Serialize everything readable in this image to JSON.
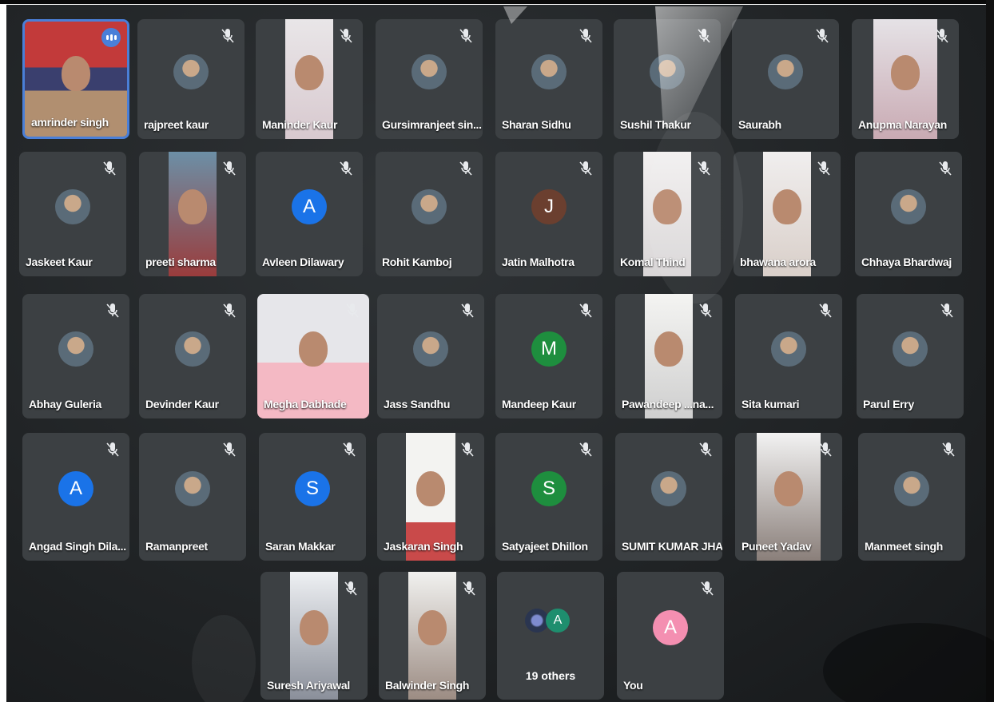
{
  "meeting": {
    "participants": [
      {
        "name": "amrinder singh",
        "pinned": true
      },
      {
        "name": "rajpreet kaur"
      },
      {
        "name": "Maninder Kaur"
      },
      {
        "name": "Gursimranjeet sin..."
      },
      {
        "name": "Sharan Sidhu"
      },
      {
        "name": "Sushil Thakur"
      },
      {
        "name": "Saurabh"
      },
      {
        "name": "Anupma Narayan"
      },
      {
        "name": "Jaskeet Kaur"
      },
      {
        "name": "preeti sharma"
      },
      {
        "name": "Avleen Dilawary",
        "initial": "A"
      },
      {
        "name": "Rohit Kamboj"
      },
      {
        "name": "Jatin Malhotra",
        "initial": "J"
      },
      {
        "name": "Komal Thind"
      },
      {
        "name": "bhawana arora"
      },
      {
        "name": "Chhaya Bhardwaj"
      },
      {
        "name": "Abhay Guleria"
      },
      {
        "name": "Devinder Kaur"
      },
      {
        "name": "Megha Dabhade"
      },
      {
        "name": "Jass Sandhu"
      },
      {
        "name": "Mandeep Kaur",
        "initial": "M"
      },
      {
        "name": "Pawandeep ...na..."
      },
      {
        "name": "Sita kumari"
      },
      {
        "name": "Parul Erry"
      },
      {
        "name": "Angad Singh Dila...",
        "initial": "A"
      },
      {
        "name": "Ramanpreet"
      },
      {
        "name": "Saran Makkar",
        "initial": "S"
      },
      {
        "name": "Jaskaran Singh"
      },
      {
        "name": "Satyajeet Dhillon",
        "initial": "S"
      },
      {
        "name": "SUMIT KUMAR JHA"
      },
      {
        "name": "Puneet Yadav"
      },
      {
        "name": "Manmeet singh"
      },
      {
        "name": "Suresh Ariyawal"
      },
      {
        "name": "Balwinder Singh"
      }
    ],
    "others": {
      "label": "19 others",
      "initial": "A"
    },
    "self": {
      "name": "You",
      "initial": "A"
    },
    "colors": {
      "tile": "#3c4043",
      "accent": "#4a7fd8",
      "avatar_blue": "#1a73e8",
      "avatar_green": "#1e8e3e",
      "avatar_pink": "#f48fb1"
    },
    "icons": {
      "mute": "mic-off-icon",
      "speaking": "audio-level-icon"
    }
  }
}
